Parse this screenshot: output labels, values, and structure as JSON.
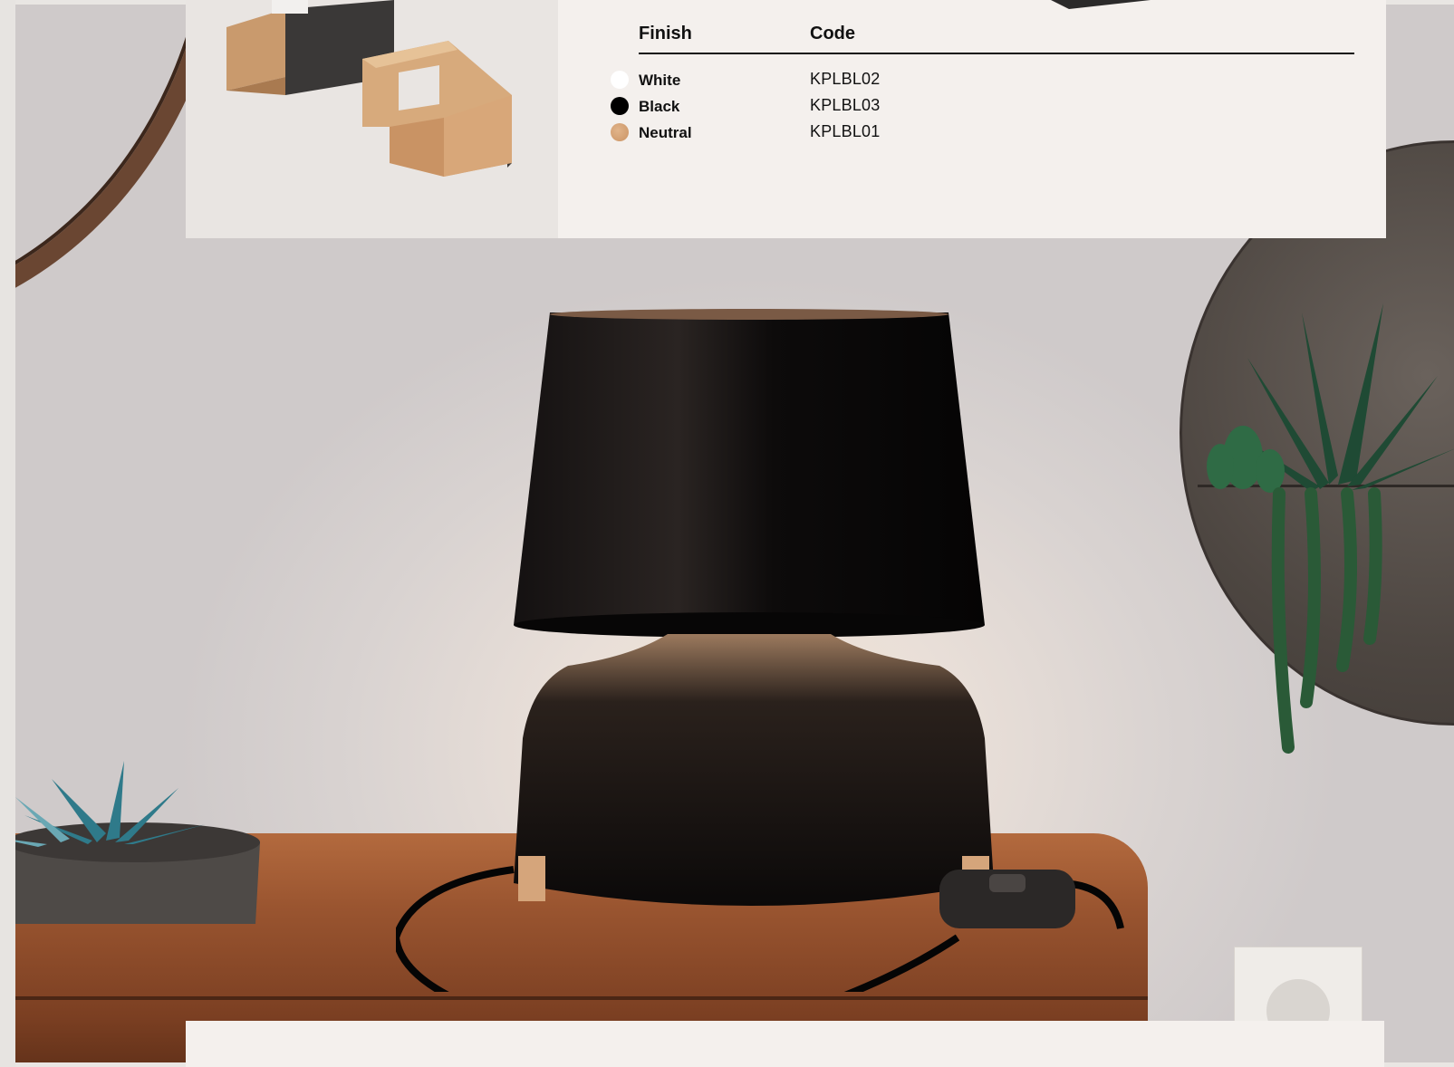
{
  "table": {
    "headers": {
      "finish": "Finish",
      "code": "Code"
    },
    "rows": [
      {
        "finish": "White",
        "code": "KPLBL02",
        "swatch": "#ffffff"
      },
      {
        "finish": "Black",
        "code": "KPLBL03",
        "swatch": "#000000"
      },
      {
        "finish": "Neutral",
        "code": "KPLBL01",
        "swatch": "#d4a174"
      }
    ]
  },
  "colors": {
    "panel": "#f4f0ed",
    "thumb_bg": "#e9e5e2",
    "lamp": "#0d0b0b",
    "wood": "#9a5530"
  },
  "images": {
    "product_thumbnail": "wooden-lamp-base-pieces",
    "hero_photo": "black-table-lamp-on-wooden-sideboard"
  }
}
